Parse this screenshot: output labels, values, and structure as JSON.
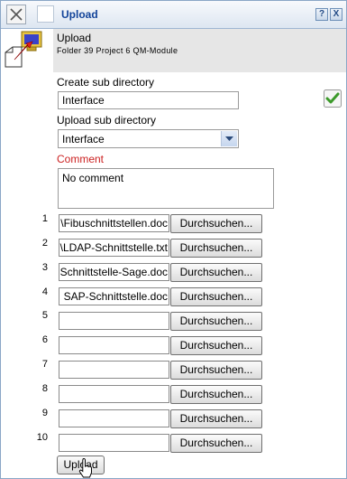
{
  "window": {
    "title": "Upload",
    "help_label": "?",
    "close_label": "X"
  },
  "header": {
    "title": "Upload",
    "subtitle": "Folder 39 Project 6 QM-Module"
  },
  "form": {
    "create_subdir_label": "Create sub directory",
    "create_subdir_value": "Interface",
    "upload_subdir_label": "Upload sub directory",
    "upload_subdir_value": "Interface",
    "comment_label": "Comment",
    "comment_value": "No comment"
  },
  "files": [
    {
      "num": "1",
      "value": "\\Fibuschnittstellen.doc",
      "browse_label": "Durchsuchen..."
    },
    {
      "num": "2",
      "value": "\\LDAP-Schnittstelle.txt",
      "browse_label": "Durchsuchen..."
    },
    {
      "num": "3",
      "value": "Schnittstelle-Sage.doc",
      "browse_label": "Durchsuchen..."
    },
    {
      "num": "4",
      "value": "SAP-Schnittstelle.doc",
      "browse_label": "Durchsuchen..."
    },
    {
      "num": "5",
      "value": "",
      "browse_label": "Durchsuchen..."
    },
    {
      "num": "6",
      "value": "",
      "browse_label": "Durchsuchen..."
    },
    {
      "num": "7",
      "value": "",
      "browse_label": "Durchsuchen..."
    },
    {
      "num": "8",
      "value": "",
      "browse_label": "Durchsuchen..."
    },
    {
      "num": "9",
      "value": "",
      "browse_label": "Durchsuchen..."
    },
    {
      "num": "10",
      "value": "",
      "browse_label": "Durchsuchen..."
    }
  ],
  "actions": {
    "upload_label": "Upload"
  },
  "colors": {
    "title_text": "#13449a",
    "comment_label": "#cc2222",
    "check_green": "#3c9a2a"
  }
}
